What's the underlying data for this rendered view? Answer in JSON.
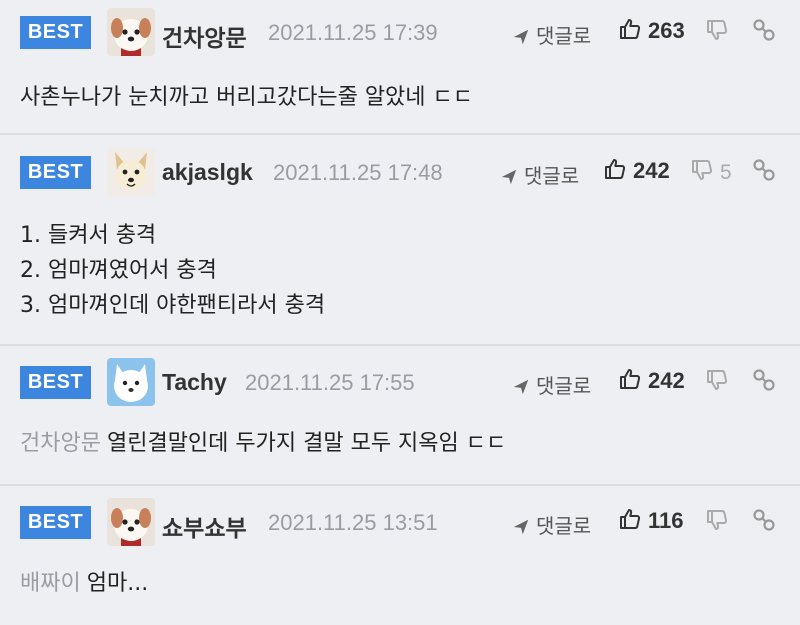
{
  "comments": [
    {
      "badge": "BEST",
      "nickname": "건차앙문",
      "date": "2021.11.25 17:39",
      "reply_label": "댓글로",
      "likes": "263",
      "dislikes": "",
      "avatar": "puppy-avatar",
      "mention": "",
      "lines": [
        "사촌누나가 눈치까고 버리고갔다는줄 알았네 ㄷㄷ"
      ]
    },
    {
      "badge": "BEST",
      "nickname": "akjaslgk",
      "date": "2021.11.25 17:48",
      "reply_label": "댓글로",
      "likes": "242",
      "dislikes": "5",
      "avatar": "dog-face-avatar",
      "mention": "",
      "lines": [
        "1. 들켜서 충격",
        "2. 엄마껴였어서 충격",
        "3. 엄마껴인데 야한팬티라서 충격"
      ]
    },
    {
      "badge": "BEST",
      "nickname": "Tachy",
      "date": "2021.11.25 17:55",
      "reply_label": "댓글로",
      "likes": "242",
      "dislikes": "",
      "avatar": "white-dog-avatar",
      "mention": "건차앙문",
      "lines": [
        "열린결말인데 두가지 결말 모두 지옥임 ㄷㄷ"
      ]
    },
    {
      "badge": "BEST",
      "nickname": "쇼부쇼부",
      "date": "2021.11.25 13:51",
      "reply_label": "댓글로",
      "likes": "116",
      "dislikes": "",
      "avatar": "puppy-avatar",
      "mention": "배짜이",
      "lines": [
        "엄마..."
      ]
    }
  ],
  "colors": {
    "badge": "#3d86e0",
    "background": "#eeeff3",
    "muted": "#9a9ca4"
  },
  "icons": [
    "reply-arrow-icon",
    "thumbs-up-icon",
    "thumbs-down-icon",
    "report-link-icon"
  ]
}
